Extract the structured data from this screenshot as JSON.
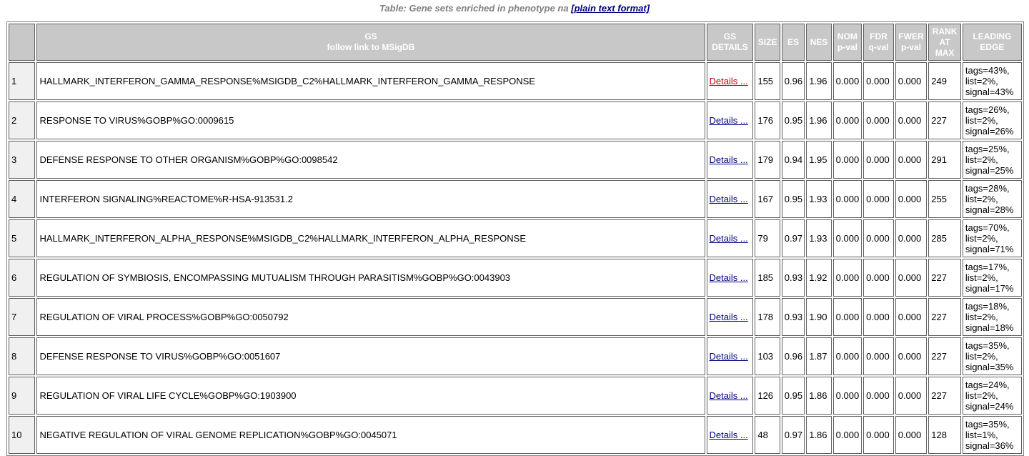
{
  "caption": {
    "text": "Table: Gene sets enriched in phenotype na",
    "link": "[plain text format]"
  },
  "headers": {
    "gs_line1": "GS",
    "gs_line2": "follow link to MSigDB",
    "details_line1": "GS",
    "details_line2": "DETAILS",
    "size": "SIZE",
    "es": "ES",
    "nes": "NES",
    "nom_line1": "NOM",
    "nom_line2": "p-val",
    "fdr_line1": "FDR",
    "fdr_line2": "q-val",
    "fwer_line1": "FWER",
    "fwer_line2": "p-val",
    "rank_line1": "RANK",
    "rank_line2": "AT",
    "rank_line3": "MAX",
    "edge_line1": "LEADING",
    "edge_line2": "EDGE"
  },
  "rows": [
    {
      "rank": "1",
      "name": "HALLMARK_INTERFERON_GAMMA_RESPONSE%MSIGDB_C2%HALLMARK_INTERFERON_GAMMA_RESPONSE",
      "details": "Details ...",
      "size": "155",
      "es": "0.96",
      "nes": "1.96",
      "nom": "0.000",
      "fdr": "0.000",
      "fwer": "0.000",
      "rank_at_max": "249",
      "edge_tags": "tags=43%,",
      "edge_list": "list=2%,",
      "edge_signal": "signal=43%"
    },
    {
      "rank": "2",
      "name": "RESPONSE TO VIRUS%GOBP%GO:0009615",
      "details": "Details ...",
      "size": "176",
      "es": "0.95",
      "nes": "1.96",
      "nom": "0.000",
      "fdr": "0.000",
      "fwer": "0.000",
      "rank_at_max": "227",
      "edge_tags": "tags=26%,",
      "edge_list": "list=2%,",
      "edge_signal": "signal=26%"
    },
    {
      "rank": "3",
      "name": "DEFENSE RESPONSE TO OTHER ORGANISM%GOBP%GO:0098542",
      "details": "Details ...",
      "size": "179",
      "es": "0.94",
      "nes": "1.95",
      "nom": "0.000",
      "fdr": "0.000",
      "fwer": "0.000",
      "rank_at_max": "291",
      "edge_tags": "tags=25%,",
      "edge_list": "list=2%,",
      "edge_signal": "signal=25%"
    },
    {
      "rank": "4",
      "name": "INTERFERON SIGNALING%REACTOME%R-HSA-913531.2",
      "details": "Details ...",
      "size": "167",
      "es": "0.95",
      "nes": "1.93",
      "nom": "0.000",
      "fdr": "0.000",
      "fwer": "0.000",
      "rank_at_max": "255",
      "edge_tags": "tags=28%,",
      "edge_list": "list=2%,",
      "edge_signal": "signal=28%"
    },
    {
      "rank": "5",
      "name": "HALLMARK_INTERFERON_ALPHA_RESPONSE%MSIGDB_C2%HALLMARK_INTERFERON_ALPHA_RESPONSE",
      "details": "Details ...",
      "size": "79",
      "es": "0.97",
      "nes": "1.93",
      "nom": "0.000",
      "fdr": "0.000",
      "fwer": "0.000",
      "rank_at_max": "285",
      "edge_tags": "tags=70%,",
      "edge_list": "list=2%,",
      "edge_signal": "signal=71%"
    },
    {
      "rank": "6",
      "name": "REGULATION OF SYMBIOSIS, ENCOMPASSING MUTUALISM THROUGH PARASITISM%GOBP%GO:0043903",
      "details": "Details ...",
      "size": "185",
      "es": "0.93",
      "nes": "1.92",
      "nom": "0.000",
      "fdr": "0.000",
      "fwer": "0.000",
      "rank_at_max": "227",
      "edge_tags": "tags=17%,",
      "edge_list": "list=2%,",
      "edge_signal": "signal=17%"
    },
    {
      "rank": "7",
      "name": "REGULATION OF VIRAL PROCESS%GOBP%GO:0050792",
      "details": "Details ...",
      "size": "178",
      "es": "0.93",
      "nes": "1.90",
      "nom": "0.000",
      "fdr": "0.000",
      "fwer": "0.000",
      "rank_at_max": "227",
      "edge_tags": "tags=18%,",
      "edge_list": "list=2%,",
      "edge_signal": "signal=18%"
    },
    {
      "rank": "8",
      "name": "DEFENSE RESPONSE TO VIRUS%GOBP%GO:0051607",
      "details": "Details ...",
      "size": "103",
      "es": "0.96",
      "nes": "1.87",
      "nom": "0.000",
      "fdr": "0.000",
      "fwer": "0.000",
      "rank_at_max": "227",
      "edge_tags": "tags=35%,",
      "edge_list": "list=2%,",
      "edge_signal": "signal=35%"
    },
    {
      "rank": "9",
      "name": "REGULATION OF VIRAL LIFE CYCLE%GOBP%GO:1903900",
      "details": "Details ...",
      "size": "126",
      "es": "0.95",
      "nes": "1.86",
      "nom": "0.000",
      "fdr": "0.000",
      "fwer": "0.000",
      "rank_at_max": "227",
      "edge_tags": "tags=24%,",
      "edge_list": "list=2%,",
      "edge_signal": "signal=24%"
    },
    {
      "rank": "10",
      "name": "NEGATIVE REGULATION OF VIRAL GENOME REPLICATION%GOBP%GO:0045071",
      "details": "Details ...",
      "size": "48",
      "es": "0.97",
      "nes": "1.86",
      "nom": "0.000",
      "fdr": "0.000",
      "fwer": "0.000",
      "rank_at_max": "128",
      "edge_tags": "tags=35%,",
      "edge_list": "list=1%,",
      "edge_signal": "signal=36%"
    }
  ],
  "colors": {
    "header_bg": "#c8c8c8",
    "rank_cell_bg": "#f0f0f0",
    "link": "#000080",
    "visited_link": "#c00000",
    "caption": "#808080"
  }
}
